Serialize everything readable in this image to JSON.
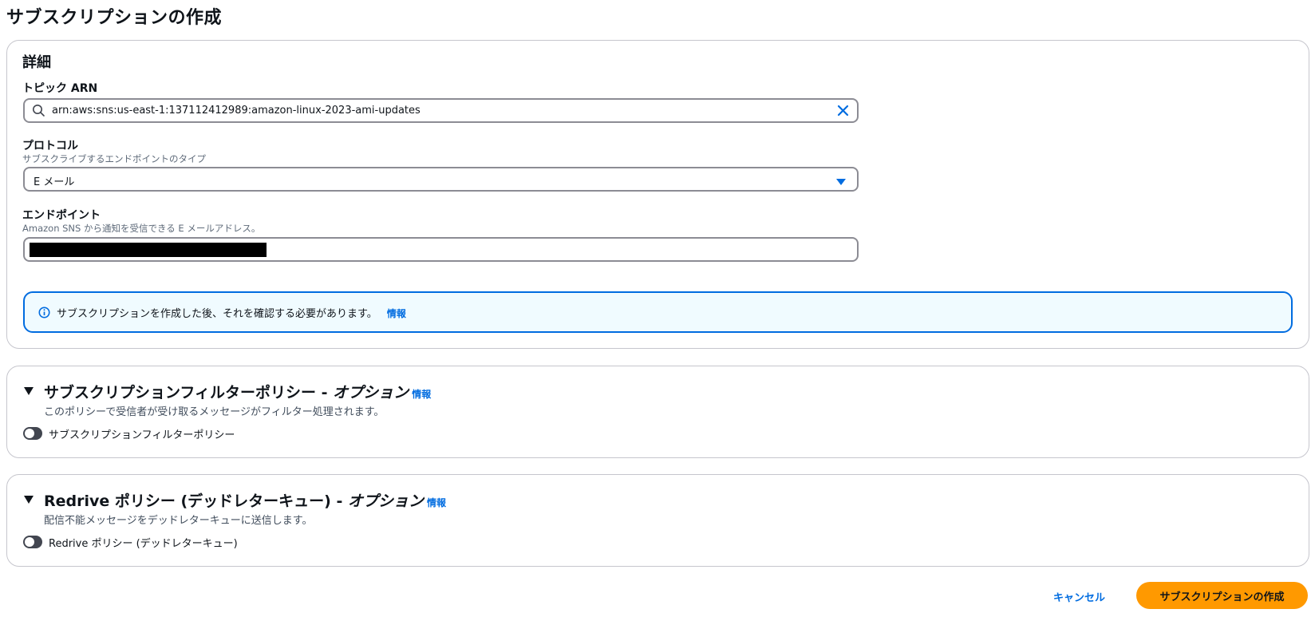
{
  "page": {
    "title": "サブスクリプションの作成"
  },
  "details": {
    "heading": "詳細",
    "topic_arn": {
      "label": "トピック ARN",
      "value": "arn:aws:sns:us-east-1:137112412989:amazon-linux-2023-ami-updates"
    },
    "protocol": {
      "label": "プロトコル",
      "description": "サブスクライブするエンドポイントのタイプ",
      "value": "E メール"
    },
    "endpoint": {
      "label": "エンドポイント",
      "description": "Amazon SNS から通知を受信できる E メールアドレス。"
    },
    "alert": {
      "text": "サブスクリプションを作成した後、それを確認する必要があります。",
      "link": "情報"
    }
  },
  "filter_policy": {
    "title": "サブスクリプションフィルターポリシー - ",
    "title_optional": "オプション",
    "info": "情報",
    "description": "このポリシーで受信者が受け取るメッセージがフィルター処理されます。",
    "toggle_label": "サブスクリプションフィルターポリシー",
    "enabled": false
  },
  "redrive_policy": {
    "title": "Redrive ポリシー (デッドレターキュー) - ",
    "title_optional": "オプション",
    "info": "情報",
    "description": "配信不能メッセージをデッドレターキューに送信します。",
    "toggle_label": "Redrive ポリシー (デッドレターキュー)",
    "enabled": false
  },
  "actions": {
    "cancel": "キャンセル",
    "create": "サブスクリプションの作成"
  },
  "colors": {
    "accent": "#006ce0",
    "primary_button": "#ff9900",
    "alert_bg": "#f0fbff"
  }
}
